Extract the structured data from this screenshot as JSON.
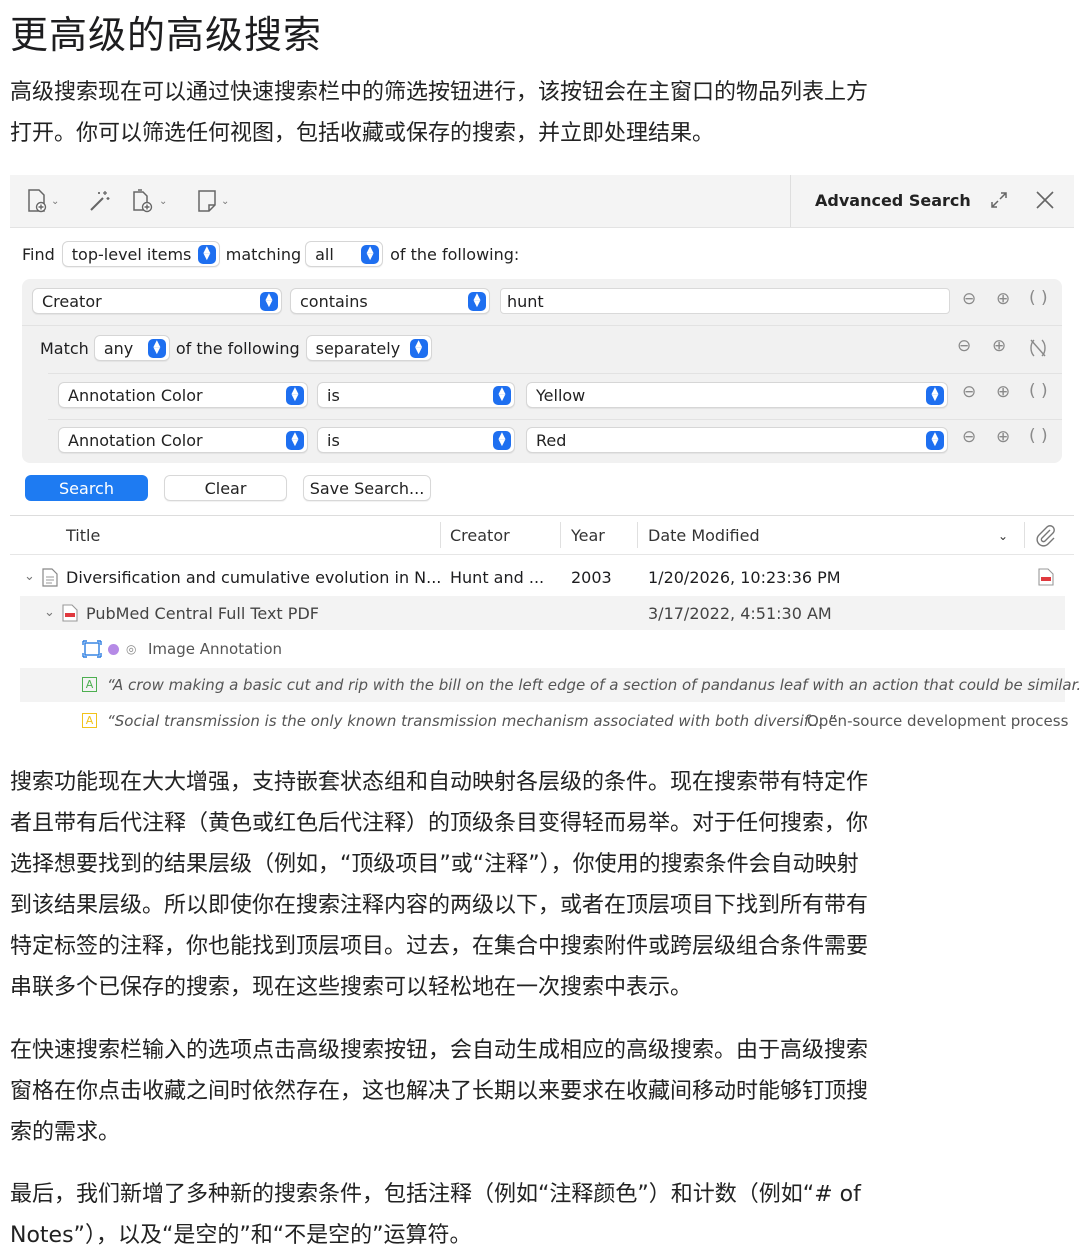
{
  "heading": "更高级的高级搜索",
  "intro": [
    "高级搜索现在可以通过快速搜索栏中的筛选按钮进行，该按钮会在主窗口的物品列表上方",
    "打开。你可以筛选任何视图，包括收藏或保存的搜索，并立即处理结果。"
  ],
  "panel": {
    "title": "Advanced Search",
    "find": {
      "label": "Find",
      "scope": "top-level items",
      "matching_label": "matching",
      "mode": "all",
      "suffix": "of the following:"
    },
    "condition1": {
      "field": "Creator",
      "op": "contains",
      "value": "hunt"
    },
    "match_row": {
      "label": "Match",
      "mode": "any",
      "middle": "of the following",
      "scope": "separately"
    },
    "sub1": {
      "field": "Annotation Color",
      "op": "is",
      "value": "Yellow"
    },
    "sub2": {
      "field": "Annotation Color",
      "op": "is",
      "value": "Red"
    },
    "buttons": {
      "search": "Search",
      "clear": "Clear",
      "save": "Save Search..."
    },
    "columns": {
      "title": "Title",
      "creator": "Creator",
      "year": "Year",
      "date": "Date Modified"
    },
    "rows": [
      {
        "title": "Diversification and cumulative evolution in N...",
        "creator": "Hunt and ...",
        "year": "2003",
        "date": "1/20/2026, 10:23:36 PM"
      },
      {
        "title": "PubMed Central Full Text PDF",
        "date": "3/17/2022, 4:51:30 AM"
      },
      {
        "title": "Image Annotation"
      },
      {
        "quote": "“A crow making a basic cut and rip with the bill on the left edge of a section of pandanus leaf with an action that could be similar... ”"
      },
      {
        "quote": "“Social transmission is the only known transmission mechanism associated with both diversif... ”",
        "extra": "Open-source development process"
      }
    ],
    "colors": {
      "accent": "#1e7bf2",
      "yellow": "#f2c31a",
      "green": "#4caf50",
      "purple": "#b58ae6"
    }
  },
  "body": [
    [
      "搜索功能现在大大增强，支持嵌套状态组和自动映射各层级的条件。现在搜索带有特定作",
      "者且带有后代注释（黄色或红色后代注释）的顶级条目变得轻而易举。对于任何搜索，你",
      "选择想要找到的结果层级（例如，“顶级项目”或“注释”），你使用的搜索条件会自动映射",
      "到该结果层级。所以即使你在搜索注释内容的两级以下，或者在顶层项目下找到所有带有",
      "特定标签的注释，你也能找到顶层项目。过去，在集合中搜索附件或跨层级组合条件需要",
      "串联多个已保存的搜索，现在这些搜索可以轻松地在一次搜索中表示。"
    ],
    [
      "在快速搜索栏输入的选项点击高级搜索按钮，会自动生成相应的高级搜索。由于高级搜索",
      "窗格在你点击收藏之间时依然存在，这也解决了长期以来要求在收藏间移动时能够钉顶搜",
      "索的需求。"
    ],
    [
      "最后，我们新增了多种新的搜索条件，包括注释（例如“注释颜色”）和计数（例如“# of",
      "Notes”），以及“是空的”和“不是空的”运算符。"
    ]
  ]
}
